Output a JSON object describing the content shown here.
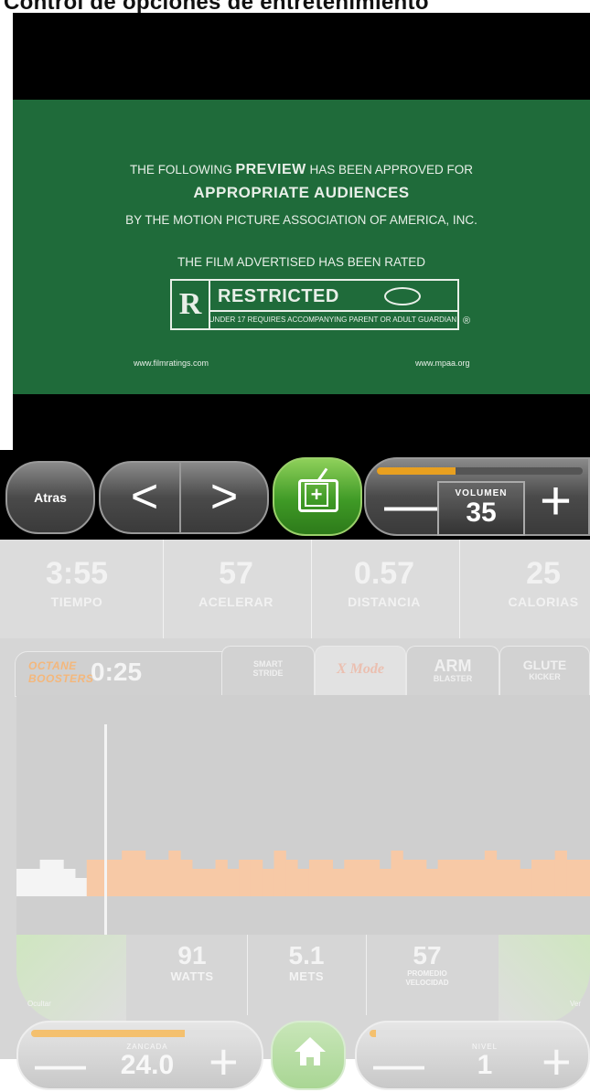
{
  "caption": {
    "text": "Control de opciones de entretenimiento"
  },
  "video": {
    "line1_pre": "THE FOLLOWING ",
    "line1_bold": "PREVIEW",
    "line1_post": " HAS BEEN APPROVED FOR",
    "line2": "APPROPRIATE AUDIENCES",
    "line3": "BY THE MOTION PICTURE ASSOCIATION OF AMERICA, INC.",
    "line4": "THE FILM ADVERTISED HAS BEEN RATED",
    "rating_letter": "R",
    "rating_word": "RESTRICTED",
    "rating_note": "UNDER 17 REQUIRES ACCOMPANYING PARENT OR ADULT GUARDIAN",
    "registered": "®",
    "url_left": "www.filmratings.com",
    "url_right": "www.mpaa.org"
  },
  "controls": {
    "back_label": "Atras",
    "prev_symbol": "<",
    "next_symbol": ">",
    "volume_label": "VOLUMEN",
    "volume_value": "35",
    "volume_level": 0.38,
    "minus": "—",
    "plus": "+"
  },
  "stats": [
    {
      "value": "3:55",
      "label": "TIEMPO"
    },
    {
      "value": "57",
      "label": "ACELERAR"
    },
    {
      "value": "0.57",
      "label": "DISTANCIA"
    },
    {
      "value": "25",
      "label": "CALORIAS"
    }
  ],
  "booster": {
    "label_line1": "OCTANE",
    "label_line2": "BOOSTERS",
    "time": "0:25"
  },
  "tabs": [
    {
      "top": "SMART",
      "bottom": "STRIDE"
    },
    {
      "text": "X Mode"
    },
    {
      "top": "ARM",
      "bottom": "BLASTER"
    },
    {
      "top": "GLUTE",
      "bottom": "KICKER"
    }
  ],
  "chart_data": {
    "type": "bar",
    "completed_values": [
      3,
      3,
      4,
      4,
      3,
      2
    ],
    "upcoming_values": [
      4,
      4,
      4,
      5,
      5,
      4,
      4,
      5,
      4,
      3,
      3,
      4,
      3,
      4,
      4,
      3,
      5,
      4,
      3,
      4,
      4,
      3,
      4,
      4,
      4,
      3,
      5,
      4,
      4,
      3,
      4,
      4,
      4,
      4,
      5,
      4,
      4,
      3,
      4,
      4,
      5,
      4,
      4
    ],
    "ylim": [
      0,
      20
    ]
  },
  "metrics": {
    "hide_left": "Ocultar",
    "hide_right": "Ver",
    "watts_value": "91",
    "watts_label": "WATTS",
    "mets_value": "5.1",
    "mets_label": "METS",
    "speed_value": "57",
    "speed_label1": "PROMEDIO",
    "speed_label2": "VELOCIDAD"
  },
  "bottom": {
    "stride_label": "ZANCADA",
    "stride_value": "24.0",
    "stride_level": 0.7,
    "level_label": "NIVEL",
    "level_value": "1",
    "level_level": 0.03,
    "minus": "—",
    "plus": "+"
  },
  "colors": {
    "video_bg": "#1f6b3a",
    "tv_button": "#3f9a26",
    "volume_fill": "#e8a020",
    "chart_upcoming": "#f7c9a6",
    "chart_done": "#f4f4f4"
  }
}
